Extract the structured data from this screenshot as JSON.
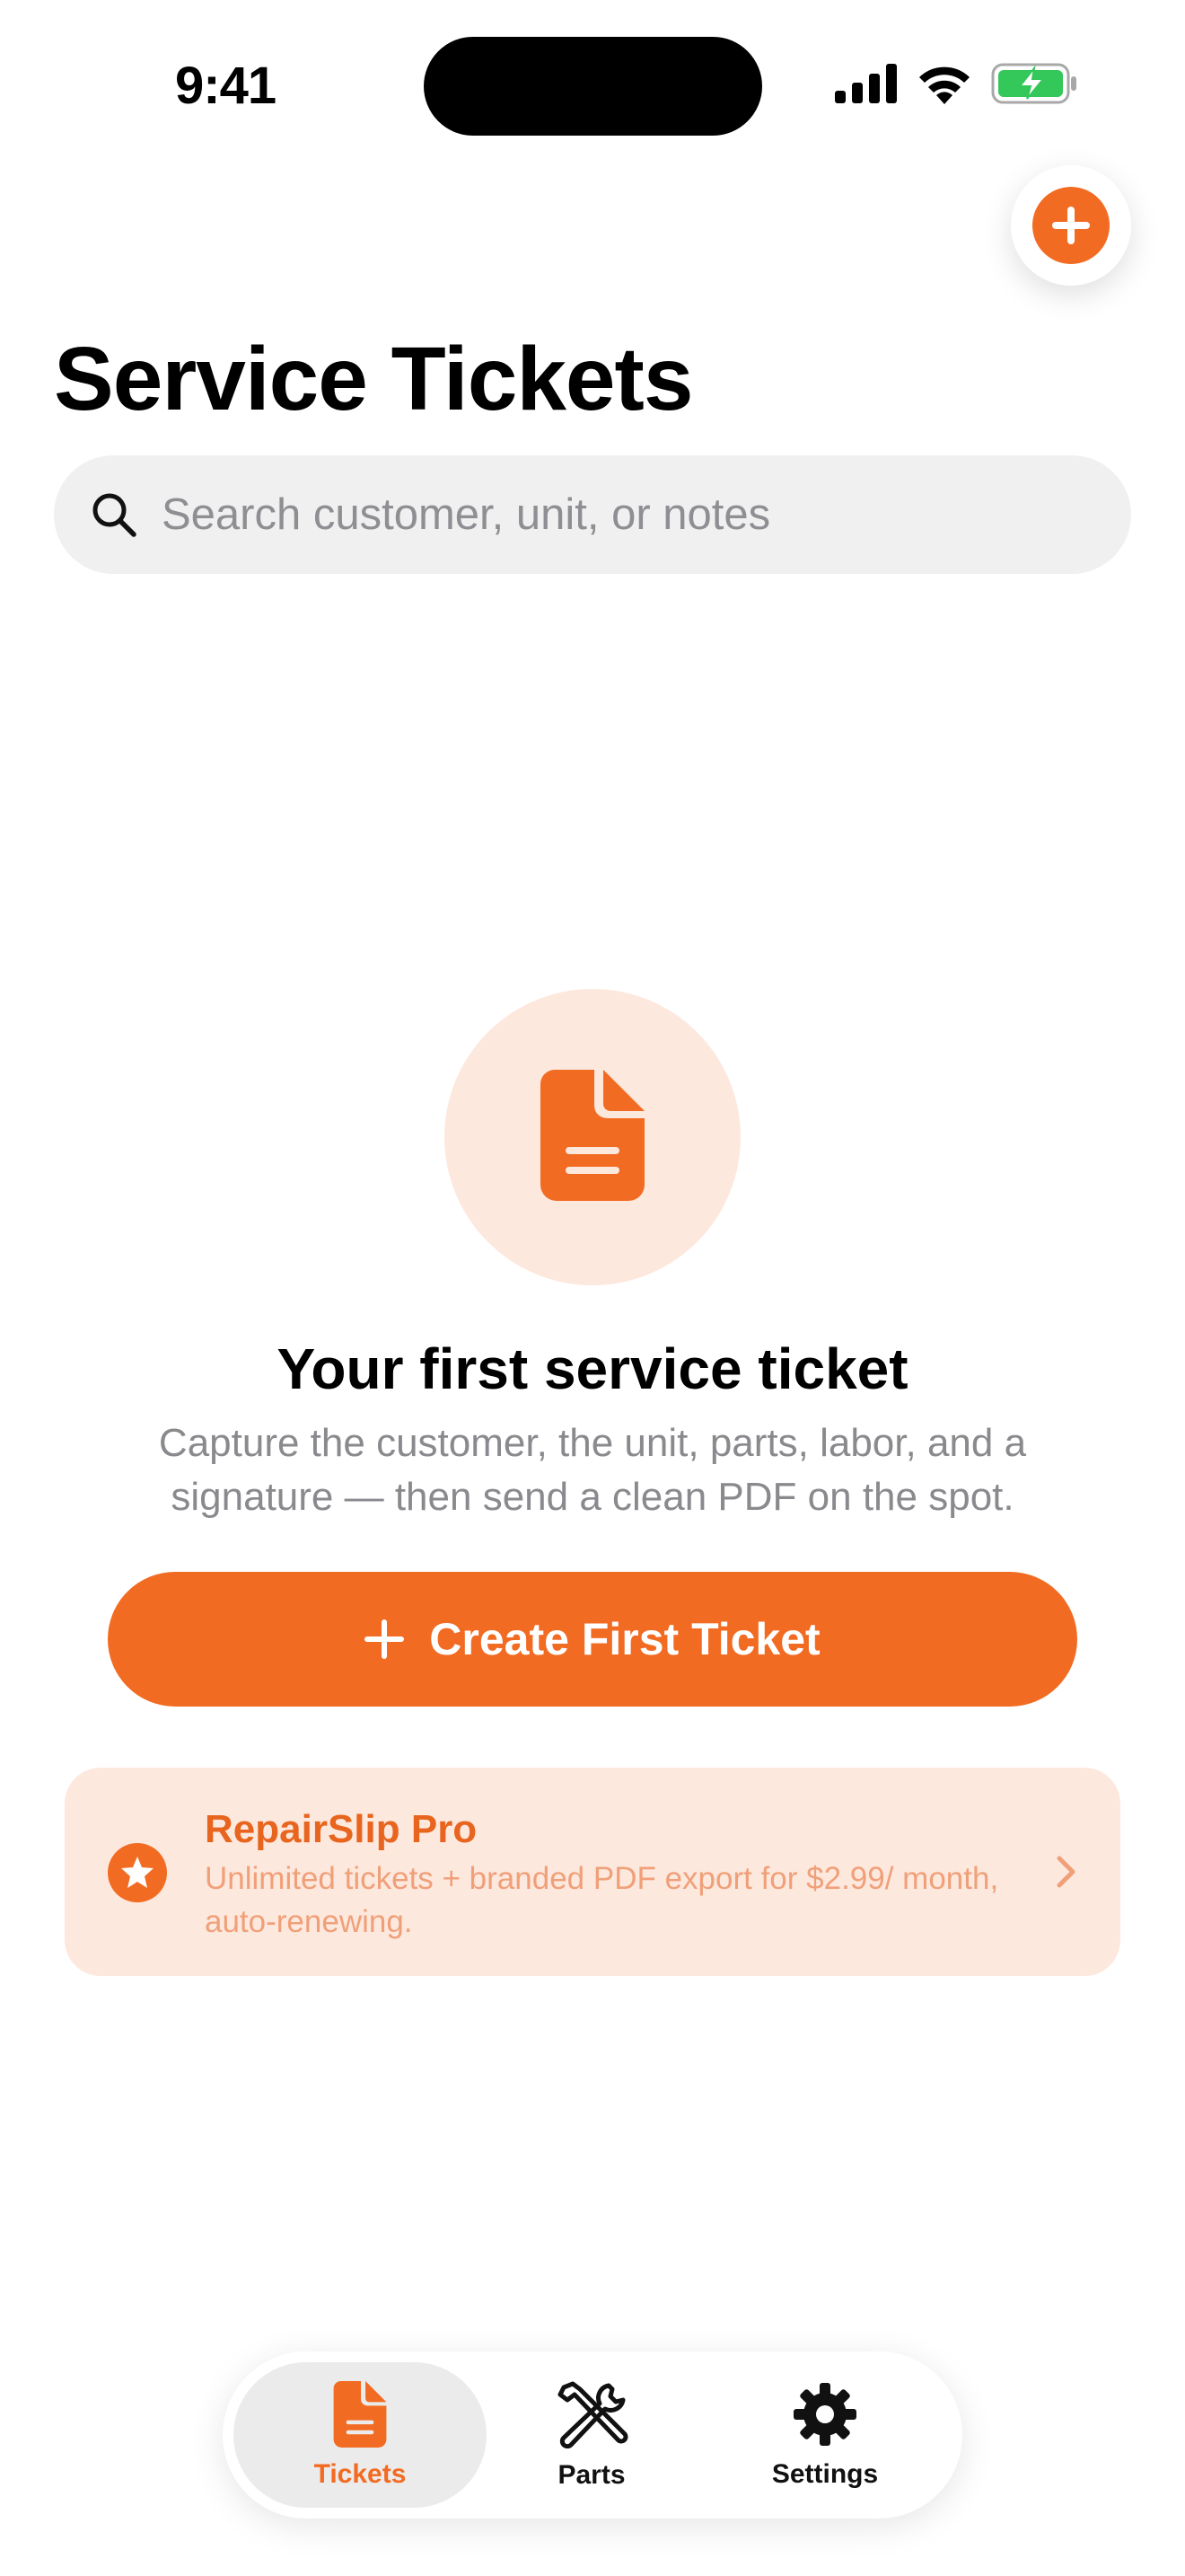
{
  "status_bar": {
    "time": "9:41"
  },
  "header": {
    "title": "Service Tickets",
    "add_icon": "plus-circle-icon"
  },
  "search": {
    "placeholder": "Search customer, unit, or notes",
    "value": ""
  },
  "empty_state": {
    "icon": "document-icon",
    "title": "Your first service ticket",
    "subtitle": "Capture the customer, the unit, parts, labor, and a signature — then send a clean PDF on the spot.",
    "cta_label": "Create First Ticket"
  },
  "pro_banner": {
    "title": "RepairSlip Pro",
    "description": "Unlimited tickets + branded PDF export for $2.99/ month, auto-renewing.",
    "icon": "star-icon"
  },
  "tab_bar": {
    "items": [
      {
        "label": "Tickets",
        "icon": "document-icon",
        "active": true
      },
      {
        "label": "Parts",
        "icon": "tools-icon",
        "active": false
      },
      {
        "label": "Settings",
        "icon": "gear-icon",
        "active": false
      }
    ]
  },
  "colors": {
    "accent": "#F26B22",
    "accent_soft": "#FDE8DE",
    "battery_green": "#34C759"
  }
}
